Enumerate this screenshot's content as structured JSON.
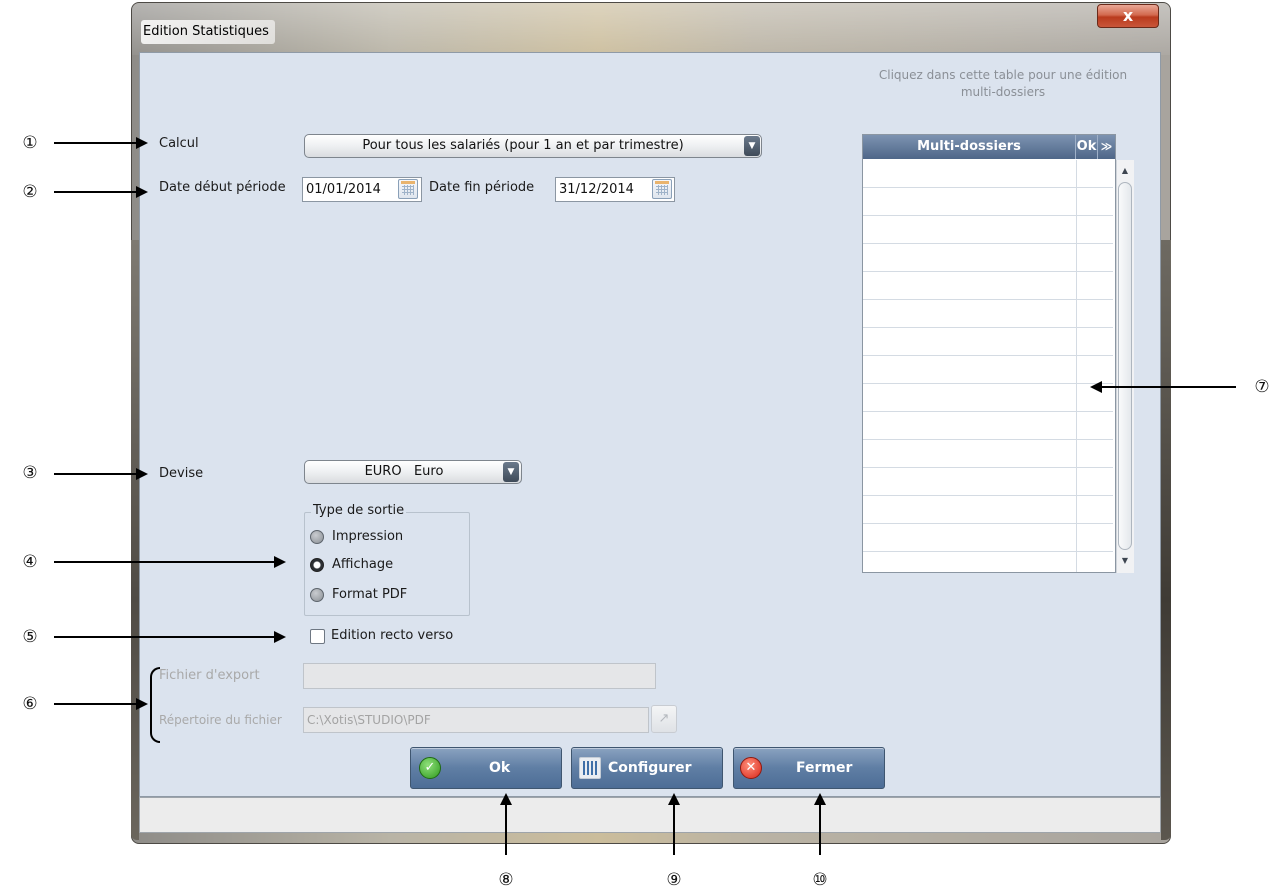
{
  "window": {
    "title": "Edition Statistiques",
    "close_glyph": "x"
  },
  "form": {
    "calcul": {
      "label": "Calcul",
      "value": "Pour tous les salariés (pour 1 an et par trimestre)"
    },
    "date_debut": {
      "label": "Date début période",
      "value": "01/01/2014"
    },
    "date_fin": {
      "label": "Date fin période",
      "value": "31/12/2014"
    },
    "devise": {
      "label": "Devise",
      "value": "EURO   Euro"
    },
    "type_sortie": {
      "title": "Type de sortie",
      "options": [
        {
          "label": "Impression",
          "selected": false
        },
        {
          "label": "Affichage",
          "selected": true
        },
        {
          "label": "Format PDF",
          "selected": false
        }
      ]
    },
    "recto_verso": {
      "label": "Edition recto verso",
      "checked": false
    },
    "fichier_export": {
      "label": "Fichier d'export",
      "value": ""
    },
    "repertoire": {
      "label": "Répertoire du fichier",
      "value": "C:\\Xotis\\STUDIO\\PDF"
    }
  },
  "table": {
    "hint": "Cliquez dans cette table pour une édition multi-dossiers",
    "columns": [
      "Multi-dossiers",
      "Ok"
    ],
    "menu_glyph": "≫",
    "scroll_up": "▲",
    "scroll_down": "▼"
  },
  "buttons": {
    "ok": "Ok",
    "configurer": "Configurer",
    "fermer": "Fermer"
  },
  "annotations": [
    "①",
    "②",
    "③",
    "④",
    "⑤",
    "⑥",
    "⑦",
    "⑧",
    "⑨",
    "⑩"
  ],
  "colors": {
    "client_bg": "#dbe3ee",
    "button_blue": "#5f7ea4",
    "table_header": "#4e6688"
  }
}
